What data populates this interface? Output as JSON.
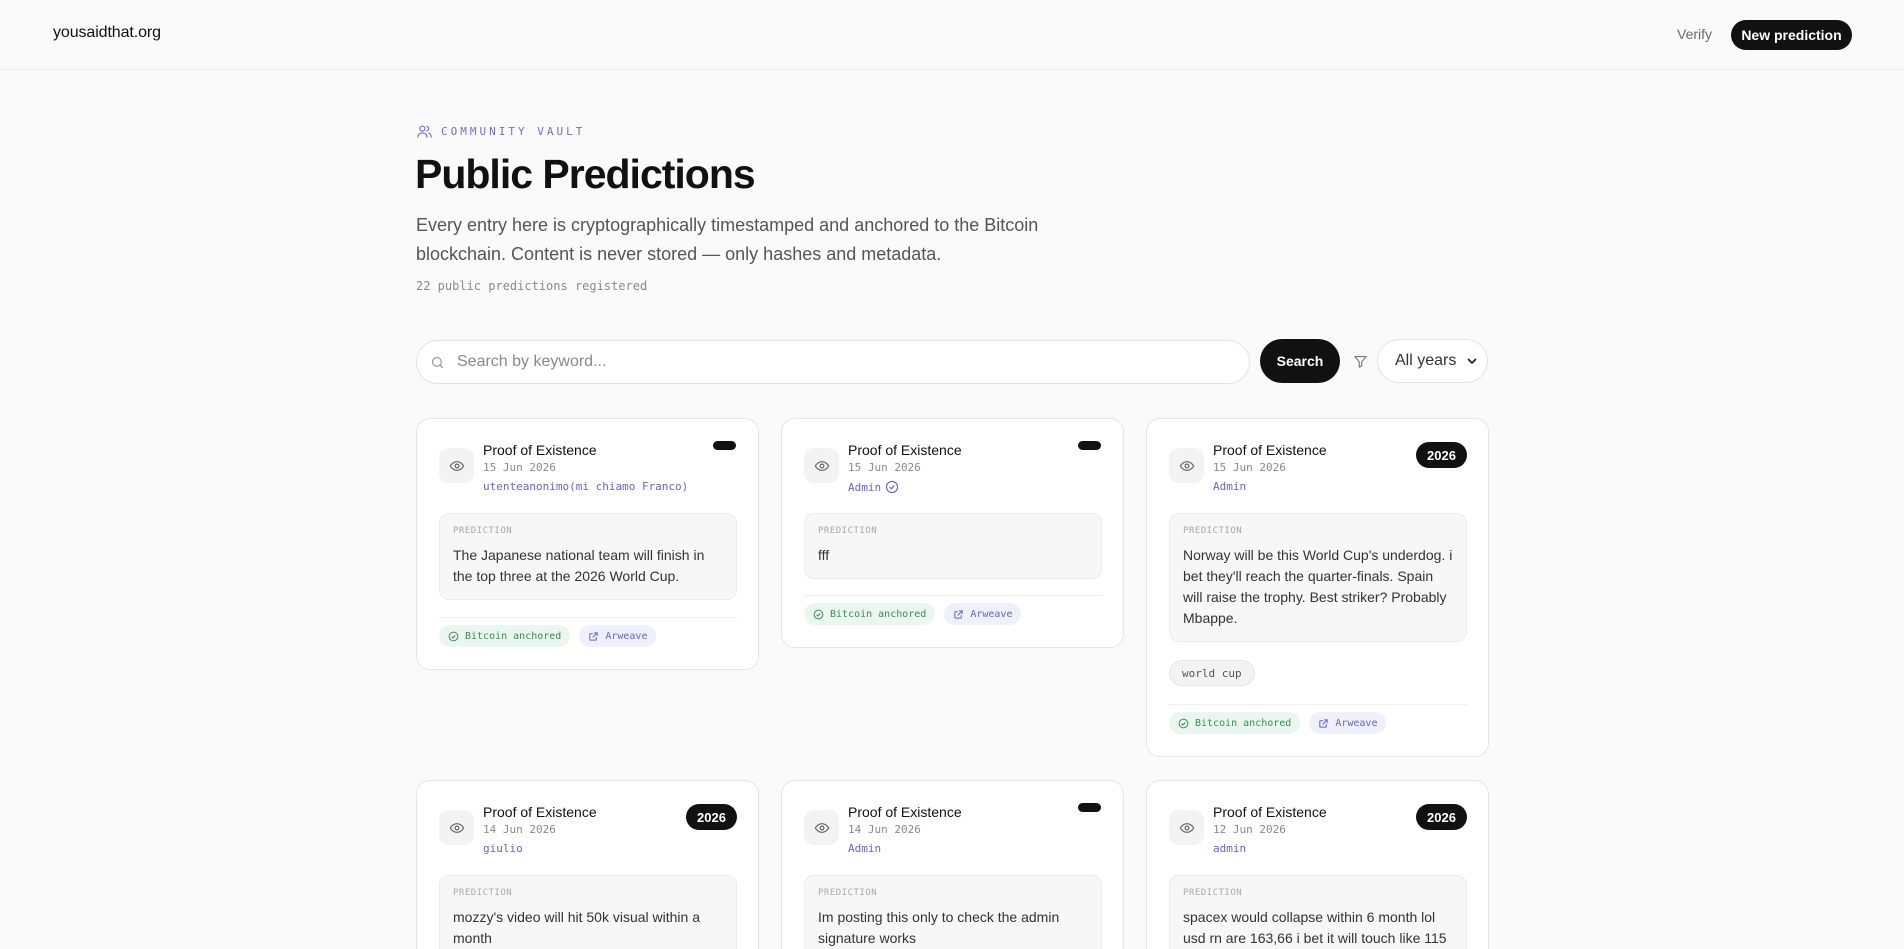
{
  "header": {
    "brand": "yousaidthat.org",
    "nav_verify": "Verify",
    "nav_new": "New prediction"
  },
  "hero": {
    "eyebrow": "COMMUNITY VAULT",
    "title": "Public Predictions",
    "description": "Every entry here is cryptographically timestamped and anchored to the Bitcoin blockchain. Content is never stored — only hashes and metadata.",
    "count_text": "22 public predictions registered"
  },
  "search": {
    "placeholder": "Search by keyword...",
    "button_label": "Search",
    "year_filter": "All years"
  },
  "card_common": {
    "type_title": "Proof of Existence",
    "prediction_label": "PREDICTION",
    "badge_bitcoin": "Bitcoin anchored",
    "badge_arweave": "Arweave"
  },
  "cards": [
    {
      "date": "15 Jun 2026",
      "author": "utenteanonimo(mi chiamo Franco)",
      "year": "",
      "prediction": "The Japanese national team will finish in the top three at the 2026 World Cup.",
      "verified": false,
      "tag": ""
    },
    {
      "date": "15 Jun 2026",
      "author": "Admin",
      "year": "",
      "prediction": "fff",
      "verified": true,
      "tag": ""
    },
    {
      "date": "15 Jun 2026",
      "author": "Admin",
      "year": "2026",
      "prediction": "Norway will be this World Cup's underdog. i bet they'll reach the quarter-finals. Spain will raise the trophy. Best striker? Probably Mbappe.",
      "verified": false,
      "tag": "world cup"
    },
    {
      "date": "14 Jun 2026",
      "author": "giulio",
      "year": "2026",
      "prediction": "mozzy's video will hit 50k visual within a month",
      "verified": false,
      "tag": ""
    },
    {
      "date": "14 Jun 2026",
      "author": "Admin",
      "year": "",
      "prediction": "Im posting this only to check the admin signature works",
      "verified": false,
      "tag": ""
    },
    {
      "date": "12 Jun 2026",
      "author": "admin",
      "year": "2026",
      "prediction": "spacex would collapse within 6 month lol usd rn are 163,66 i bet it will touch like 115",
      "verified": false,
      "tag": ""
    }
  ],
  "colors": {
    "accent": "#6565c8",
    "dark": "#111111",
    "bitcoin_badge_bg": "#eaf7ee",
    "arweave_badge_bg": "#eef0fb"
  }
}
